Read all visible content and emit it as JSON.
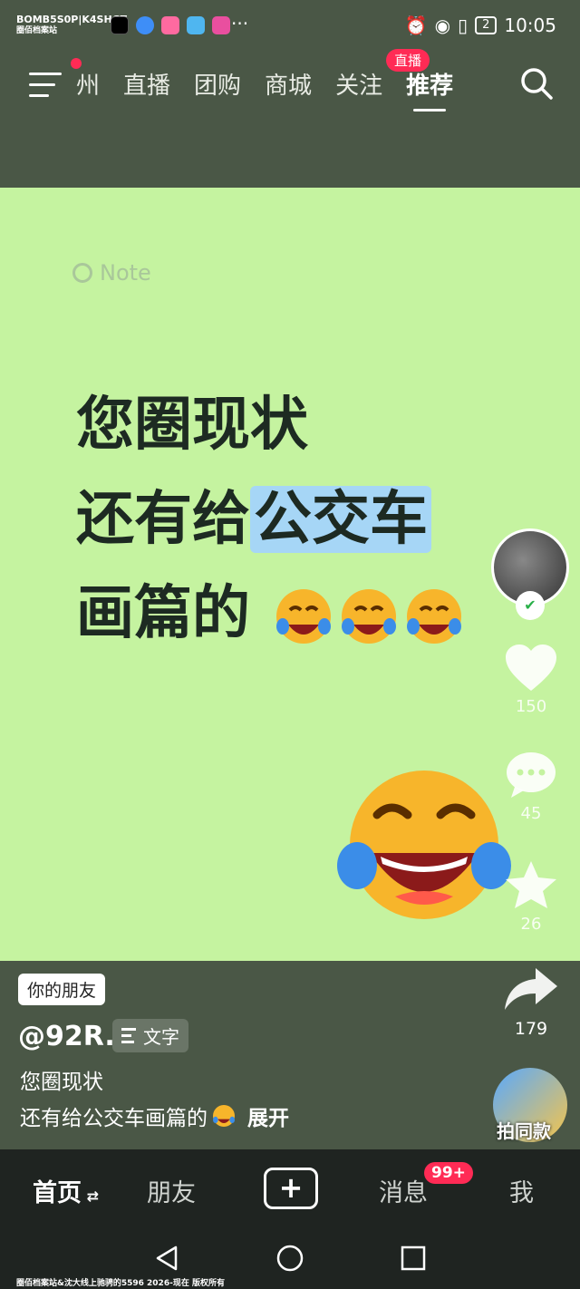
{
  "status_bar": {
    "carrier_line1": "BOMB5S0P|K4SHGT",
    "carrier_line2": "圈佰档案站",
    "more": "···",
    "sim": "2",
    "time": "10:05"
  },
  "top_nav": {
    "tabs": [
      "州",
      "直播",
      "团购",
      "商城",
      "关注",
      "推荐"
    ],
    "active_tab": "推荐",
    "live_badge": "直播"
  },
  "post": {
    "note_label": "Note",
    "line1": "您圈现状",
    "line2_prefix": "还有给",
    "line2_highlight": "公交车",
    "line3": "画篇的"
  },
  "rail": {
    "likes": "150",
    "comments": "45",
    "favorites": "26",
    "shares": "179"
  },
  "info": {
    "friend_tag": "你的朋友",
    "author": "@92R.",
    "type_tag": "文字",
    "desc_line1": "您圈现状",
    "desc_line2": "还有给公交车画篇的",
    "expand": "展开",
    "shot_label": "拍同款"
  },
  "tab_bar": {
    "home": "首页",
    "friends": "朋友",
    "messages": "消息",
    "messages_badge": "99+",
    "me": "我"
  },
  "watermark": "圈佰档案站&沈大线上驰骋的5596 2026-现在 版权所有",
  "colors": {
    "card_bg": "#c5f3a0",
    "bar_bg": "#4a5746",
    "accent": "#ff2b55",
    "highlight": "#a6d6f6"
  }
}
